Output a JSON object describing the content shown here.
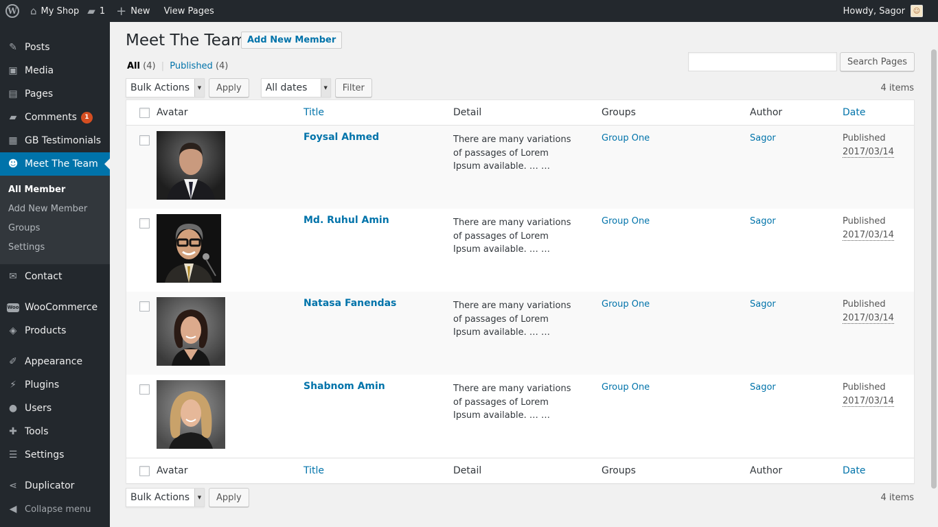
{
  "adminbar": {
    "site_name": "My Shop",
    "comments_count": "1",
    "new_label": "New",
    "view_pages": "View Pages",
    "howdy": "Howdy, Sagor"
  },
  "sidebar": {
    "items": [
      {
        "label": "Posts",
        "icon": "pin-icon"
      },
      {
        "label": "Media",
        "icon": "media-icon"
      },
      {
        "label": "Pages",
        "icon": "pages-icon"
      },
      {
        "label": "Comments",
        "icon": "comment-icon",
        "badge": "1"
      },
      {
        "label": "GB Testimonials",
        "icon": "testimonial-icon"
      },
      {
        "label": "Meet The Team",
        "icon": "groups-icon"
      },
      {
        "label": "Contact",
        "icon": "envelope-icon"
      },
      {
        "label": "WooCommerce",
        "icon": "woo-icon"
      },
      {
        "label": "Products",
        "icon": "box-icon"
      },
      {
        "label": "Appearance",
        "icon": "brush-icon"
      },
      {
        "label": "Plugins",
        "icon": "plug-icon"
      },
      {
        "label": "Users",
        "icon": "user-icon"
      },
      {
        "label": "Tools",
        "icon": "wrench-icon"
      },
      {
        "label": "Settings",
        "icon": "sliders-icon"
      },
      {
        "label": "Duplicator",
        "icon": "share-icon"
      },
      {
        "label": "Collapse menu",
        "icon": "collapse-icon"
      }
    ],
    "submenu": [
      "All Member",
      "Add New Member",
      "Groups",
      "Settings"
    ],
    "woo_badge": "Woo"
  },
  "page": {
    "title": "Meet The Team",
    "add_new": "Add New Member",
    "filter_all": "All",
    "filter_all_count": "(4)",
    "filter_sep": "|",
    "filter_published": "Published",
    "filter_published_count": "(4)",
    "search_button": "Search Pages",
    "search_value": "",
    "bulk_actions": "Bulk Actions",
    "apply": "Apply",
    "all_dates": "All dates",
    "filter": "Filter",
    "items_count": "4 items"
  },
  "table": {
    "columns": [
      "Avatar",
      "Title",
      "Detail",
      "Groups",
      "Author",
      "Date"
    ],
    "rows": [
      {
        "title": "Foysal Ahmed",
        "detail": "There are many variations of passages of Lorem Ipsum available. … …",
        "group": "Group One",
        "author": "Sagor",
        "status": "Published",
        "date": "2017/03/14"
      },
      {
        "title": "Md. Ruhul Amin",
        "detail": "There are many variations of passages of Lorem Ipsum available. … …",
        "group": "Group One",
        "author": "Sagor",
        "status": "Published",
        "date": "2017/03/14"
      },
      {
        "title": "Natasa Fanendas",
        "detail": "There are many variations of passages of Lorem Ipsum available. … …",
        "group": "Group One",
        "author": "Sagor",
        "status": "Published",
        "date": "2017/03/14"
      },
      {
        "title": "Shabnom Amin",
        "detail": "There are many variations of passages of Lorem Ipsum available. … …",
        "group": "Group One",
        "author": "Sagor",
        "status": "Published",
        "date": "2017/03/14"
      }
    ]
  },
  "colors": {
    "accent": "#0073aa",
    "sidebar_bg": "#23282d",
    "badge": "#d54e21"
  }
}
